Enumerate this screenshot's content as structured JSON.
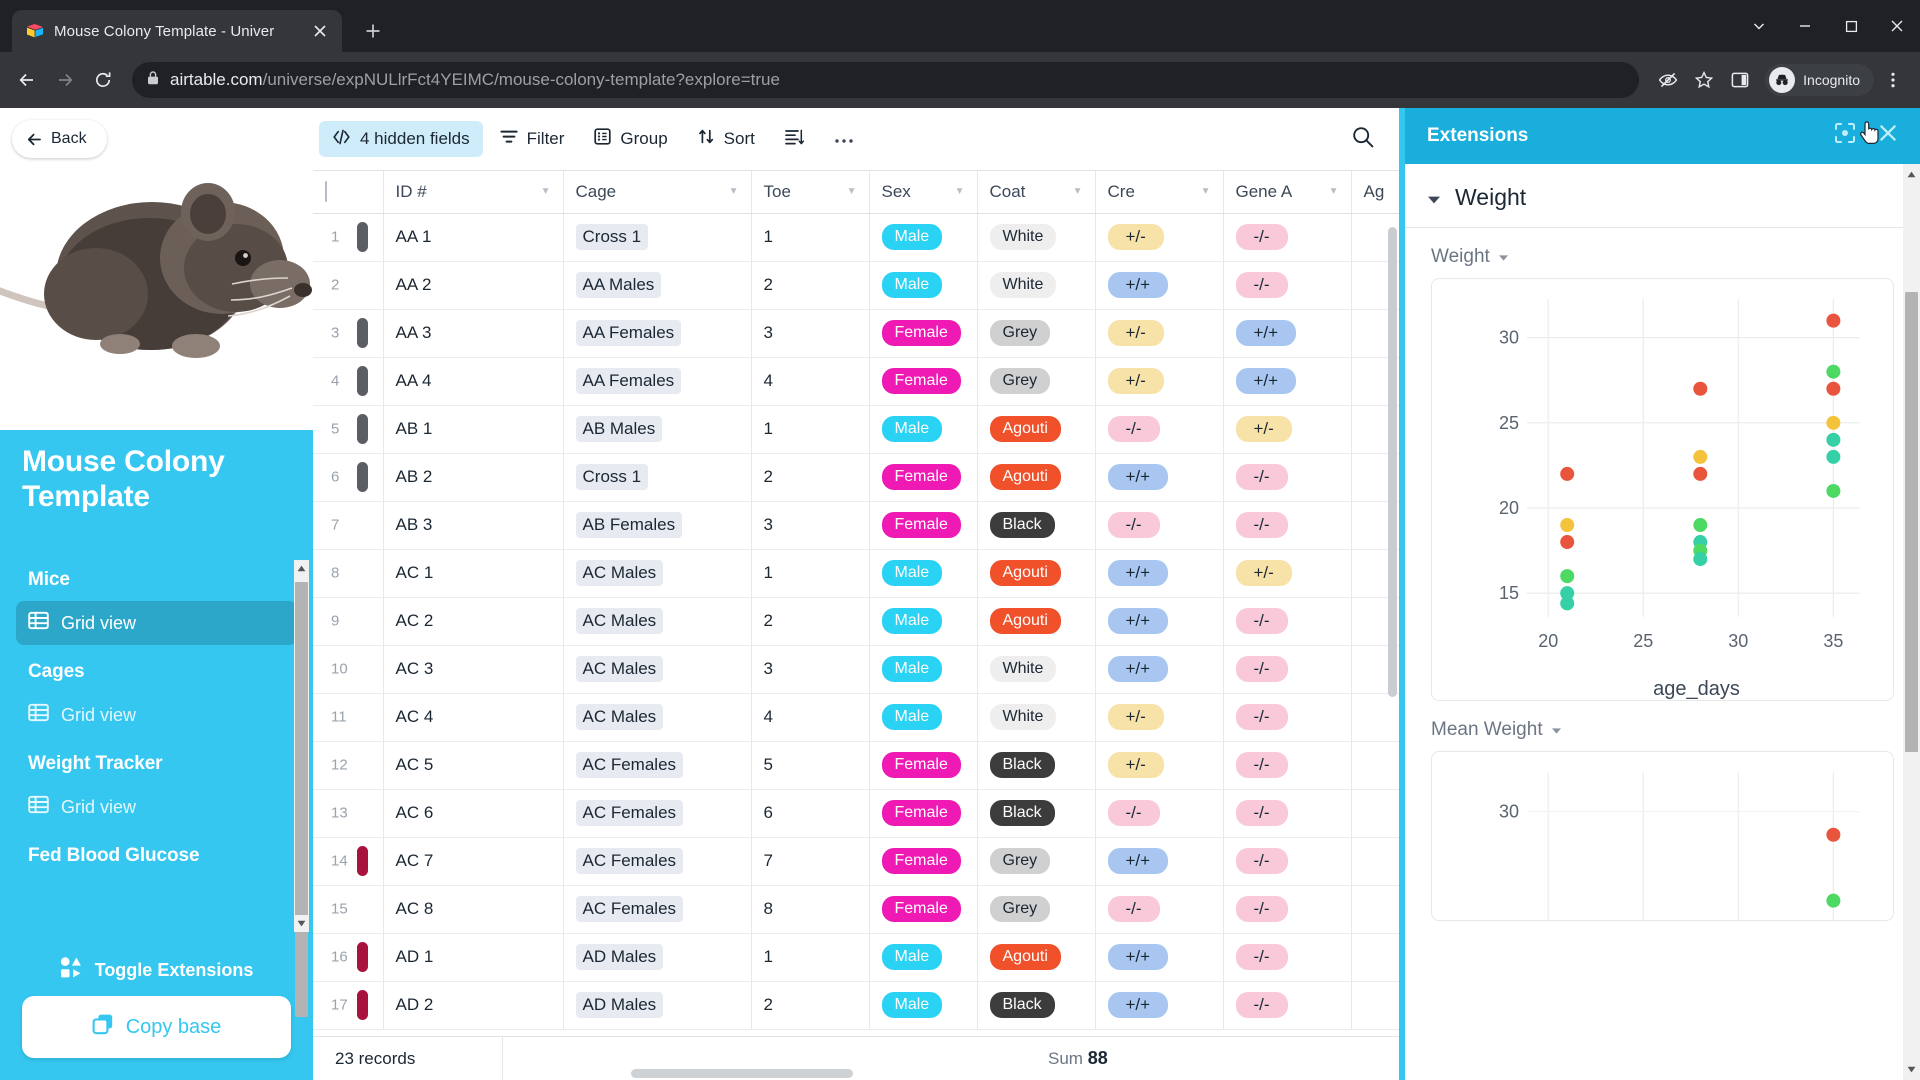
{
  "browser": {
    "tab_title": "Mouse Colony Template - Univer",
    "favicon": "airtable-icon",
    "new_tab_label": "+",
    "url_domain": "airtable.com",
    "url_path": "/universe/expNULlrFct4YEIMC/mouse-colony-template?explore=true",
    "profile_label": "Incognito",
    "icons": [
      "back-icon",
      "forward-icon",
      "reload-icon",
      "lock-icon",
      "third-party-cookie-blocked-icon",
      "bookmark-star-icon",
      "side-panel-icon",
      "incognito-icon",
      "chrome-menu-icon"
    ]
  },
  "sidebar": {
    "back_label": "Back",
    "brand_title": "Mouse Colony Template",
    "toggle_extensions_label": "Toggle Extensions",
    "copy_base_label": "Copy base",
    "groups": [
      {
        "title": "Mice",
        "items": [
          {
            "label": "Grid view",
            "active": true
          }
        ]
      },
      {
        "title": "Cages",
        "items": [
          {
            "label": "Grid view",
            "active": false
          }
        ]
      },
      {
        "title": "Weight Tracker",
        "items": [
          {
            "label": "Grid view",
            "active": false
          }
        ]
      },
      {
        "title": "Fed Blood Glucose",
        "items": []
      }
    ]
  },
  "toolbar": {
    "hidden_fields_label": "4 hidden fields",
    "filter_label": "Filter",
    "group_label": "Group",
    "sort_label": "Sort",
    "row_height_label": "",
    "more_label": "•••",
    "search_label": ""
  },
  "grid": {
    "columns": [
      "ID #",
      "Cage",
      "Toe",
      "Sex",
      "Coat",
      "Cre",
      "Gene A",
      "Ag"
    ],
    "rows": [
      {
        "n": "1",
        "bar": "#5b5f63",
        "id": "AA 1",
        "cage": "Cross 1",
        "toe": "1",
        "sex": "Male",
        "coat": "White",
        "cre": "+/-",
        "gene": "-/-"
      },
      {
        "n": "2",
        "bar": "",
        "id": "AA 2",
        "cage": "AA Males",
        "toe": "2",
        "sex": "Male",
        "coat": "White",
        "cre": "+/+",
        "gene": "-/-"
      },
      {
        "n": "3",
        "bar": "#5b5f63",
        "id": "AA 3",
        "cage": "AA Females",
        "toe": "3",
        "sex": "Female",
        "coat": "Grey",
        "cre": "+/-",
        "gene": "+/+"
      },
      {
        "n": "4",
        "bar": "#5b5f63",
        "id": "AA 4",
        "cage": "AA Females",
        "toe": "4",
        "sex": "Female",
        "coat": "Grey",
        "cre": "+/-",
        "gene": "+/+"
      },
      {
        "n": "5",
        "bar": "#5b5f63",
        "id": "AB 1",
        "cage": "AB Males",
        "toe": "1",
        "sex": "Male",
        "coat": "Agouti",
        "cre": "-/-",
        "gene": "+/-"
      },
      {
        "n": "6",
        "bar": "#5b5f63",
        "id": "AB 2",
        "cage": "Cross 1",
        "toe": "2",
        "sex": "Female",
        "coat": "Agouti",
        "cre": "+/+",
        "gene": "-/-"
      },
      {
        "n": "7",
        "bar": "",
        "id": "AB 3",
        "cage": "AB Females",
        "toe": "3",
        "sex": "Female",
        "coat": "Black",
        "cre": "-/-",
        "gene": "-/-"
      },
      {
        "n": "8",
        "bar": "",
        "id": "AC 1",
        "cage": "AC Males",
        "toe": "1",
        "sex": "Male",
        "coat": "Agouti",
        "cre": "+/+",
        "gene": "+/-"
      },
      {
        "n": "9",
        "bar": "",
        "id": "AC 2",
        "cage": "AC Males",
        "toe": "2",
        "sex": "Male",
        "coat": "Agouti",
        "cre": "+/+",
        "gene": "-/-"
      },
      {
        "n": "10",
        "bar": "",
        "id": "AC 3",
        "cage": "AC Males",
        "toe": "3",
        "sex": "Male",
        "coat": "White",
        "cre": "+/+",
        "gene": "-/-"
      },
      {
        "n": "11",
        "bar": "",
        "id": "AC 4",
        "cage": "AC Males",
        "toe": "4",
        "sex": "Male",
        "coat": "White",
        "cre": "+/-",
        "gene": "-/-"
      },
      {
        "n": "12",
        "bar": "",
        "id": "AC 5",
        "cage": "AC Females",
        "toe": "5",
        "sex": "Female",
        "coat": "Black",
        "cre": "+/-",
        "gene": "-/-"
      },
      {
        "n": "13",
        "bar": "",
        "id": "AC 6",
        "cage": "AC Females",
        "toe": "6",
        "sex": "Female",
        "coat": "Black",
        "cre": "-/-",
        "gene": "-/-"
      },
      {
        "n": "14",
        "bar": "#a8123f",
        "id": "AC 7",
        "cage": "AC Females",
        "toe": "7",
        "sex": "Female",
        "coat": "Grey",
        "cre": "+/+",
        "gene": "-/-"
      },
      {
        "n": "15",
        "bar": "",
        "id": "AC 8",
        "cage": "AC Females",
        "toe": "8",
        "sex": "Female",
        "coat": "Grey",
        "cre": "-/-",
        "gene": "-/-"
      },
      {
        "n": "16",
        "bar": "#a8123f",
        "id": "AD 1",
        "cage": "AD Males",
        "toe": "1",
        "sex": "Male",
        "coat": "Agouti",
        "cre": "+/+",
        "gene": "-/-"
      },
      {
        "n": "17",
        "bar": "#a8123f",
        "id": "AD 2",
        "cage": "AD Males",
        "toe": "2",
        "sex": "Male",
        "coat": "Black",
        "cre": "+/+",
        "gene": "-/-"
      }
    ],
    "footer_records": "23 records",
    "footer_sum_label": "Sum",
    "footer_sum_value": "88"
  },
  "extensions": {
    "title": "Extensions",
    "block_title": "Weight",
    "icons": [
      "fullscreen-icon",
      "close-icon"
    ]
  },
  "chart_data": [
    {
      "type": "scatter",
      "title": "Weight",
      "xlabel": "age_days",
      "ylabel": "",
      "xlim": [
        19.2,
        36.4
      ],
      "ylim": [
        13.6,
        31.8
      ],
      "xticks": [
        20,
        25,
        30,
        35
      ],
      "yticks": [
        15,
        20,
        25,
        30
      ],
      "grid": true,
      "legend": "none",
      "points": [
        {
          "x": 21,
          "y": 22,
          "color": "#e8553c"
        },
        {
          "x": 21,
          "y": 19,
          "color": "#f5c33b"
        },
        {
          "x": 21,
          "y": 18,
          "color": "#e8553c"
        },
        {
          "x": 21,
          "y": 16,
          "color": "#4cd964"
        },
        {
          "x": 21,
          "y": 15,
          "color": "#35d0a5"
        },
        {
          "x": 21,
          "y": 14.4,
          "color": "#35d0a5"
        },
        {
          "x": 28,
          "y": 27,
          "color": "#e8553c"
        },
        {
          "x": 28,
          "y": 23,
          "color": "#f5c33b"
        },
        {
          "x": 28,
          "y": 22,
          "color": "#e8553c"
        },
        {
          "x": 28,
          "y": 19,
          "color": "#4cd964"
        },
        {
          "x": 28,
          "y": 18,
          "color": "#35d0a5"
        },
        {
          "x": 28,
          "y": 17.5,
          "color": "#4cd964"
        },
        {
          "x": 28,
          "y": 17,
          "color": "#35d0a5"
        },
        {
          "x": 35,
          "y": 31,
          "color": "#e8553c"
        },
        {
          "x": 35,
          "y": 28,
          "color": "#4cd964"
        },
        {
          "x": 35,
          "y": 27,
          "color": "#e8553c"
        },
        {
          "x": 35,
          "y": 25,
          "color": "#f5c33b"
        },
        {
          "x": 35,
          "y": 24,
          "color": "#35d0a5"
        },
        {
          "x": 35,
          "y": 23,
          "color": "#35d0a5"
        },
        {
          "x": 35,
          "y": 21,
          "color": "#4cd964"
        }
      ]
    },
    {
      "type": "scatter",
      "title": "Mean Weight",
      "xlabel": "",
      "ylabel": "",
      "yticks": [
        30
      ],
      "grid": true,
      "legend": "none",
      "points": [
        {
          "x": 35,
          "y": 28.6,
          "color": "#e8553c"
        },
        {
          "x": 35,
          "y": 24.6,
          "color": "#4cd964"
        }
      ]
    }
  ],
  "chart_selectors": {
    "weight_selector": "Weight",
    "mean_weight_selector": "Mean Weight"
  },
  "colors": {
    "brand": "#35c7f0",
    "ext_header": "#19aedb",
    "male": "#2ad2f4",
    "female": "#ef19b4",
    "agouti": "#f0512b",
    "black": "#3c3c3c",
    "grey": "#d0d0d0",
    "white": "#eeeeee",
    "plus_minus": "#f7e2a8",
    "plus_plus": "#a8c6f0",
    "minus_minus": "#f9c9d9"
  }
}
